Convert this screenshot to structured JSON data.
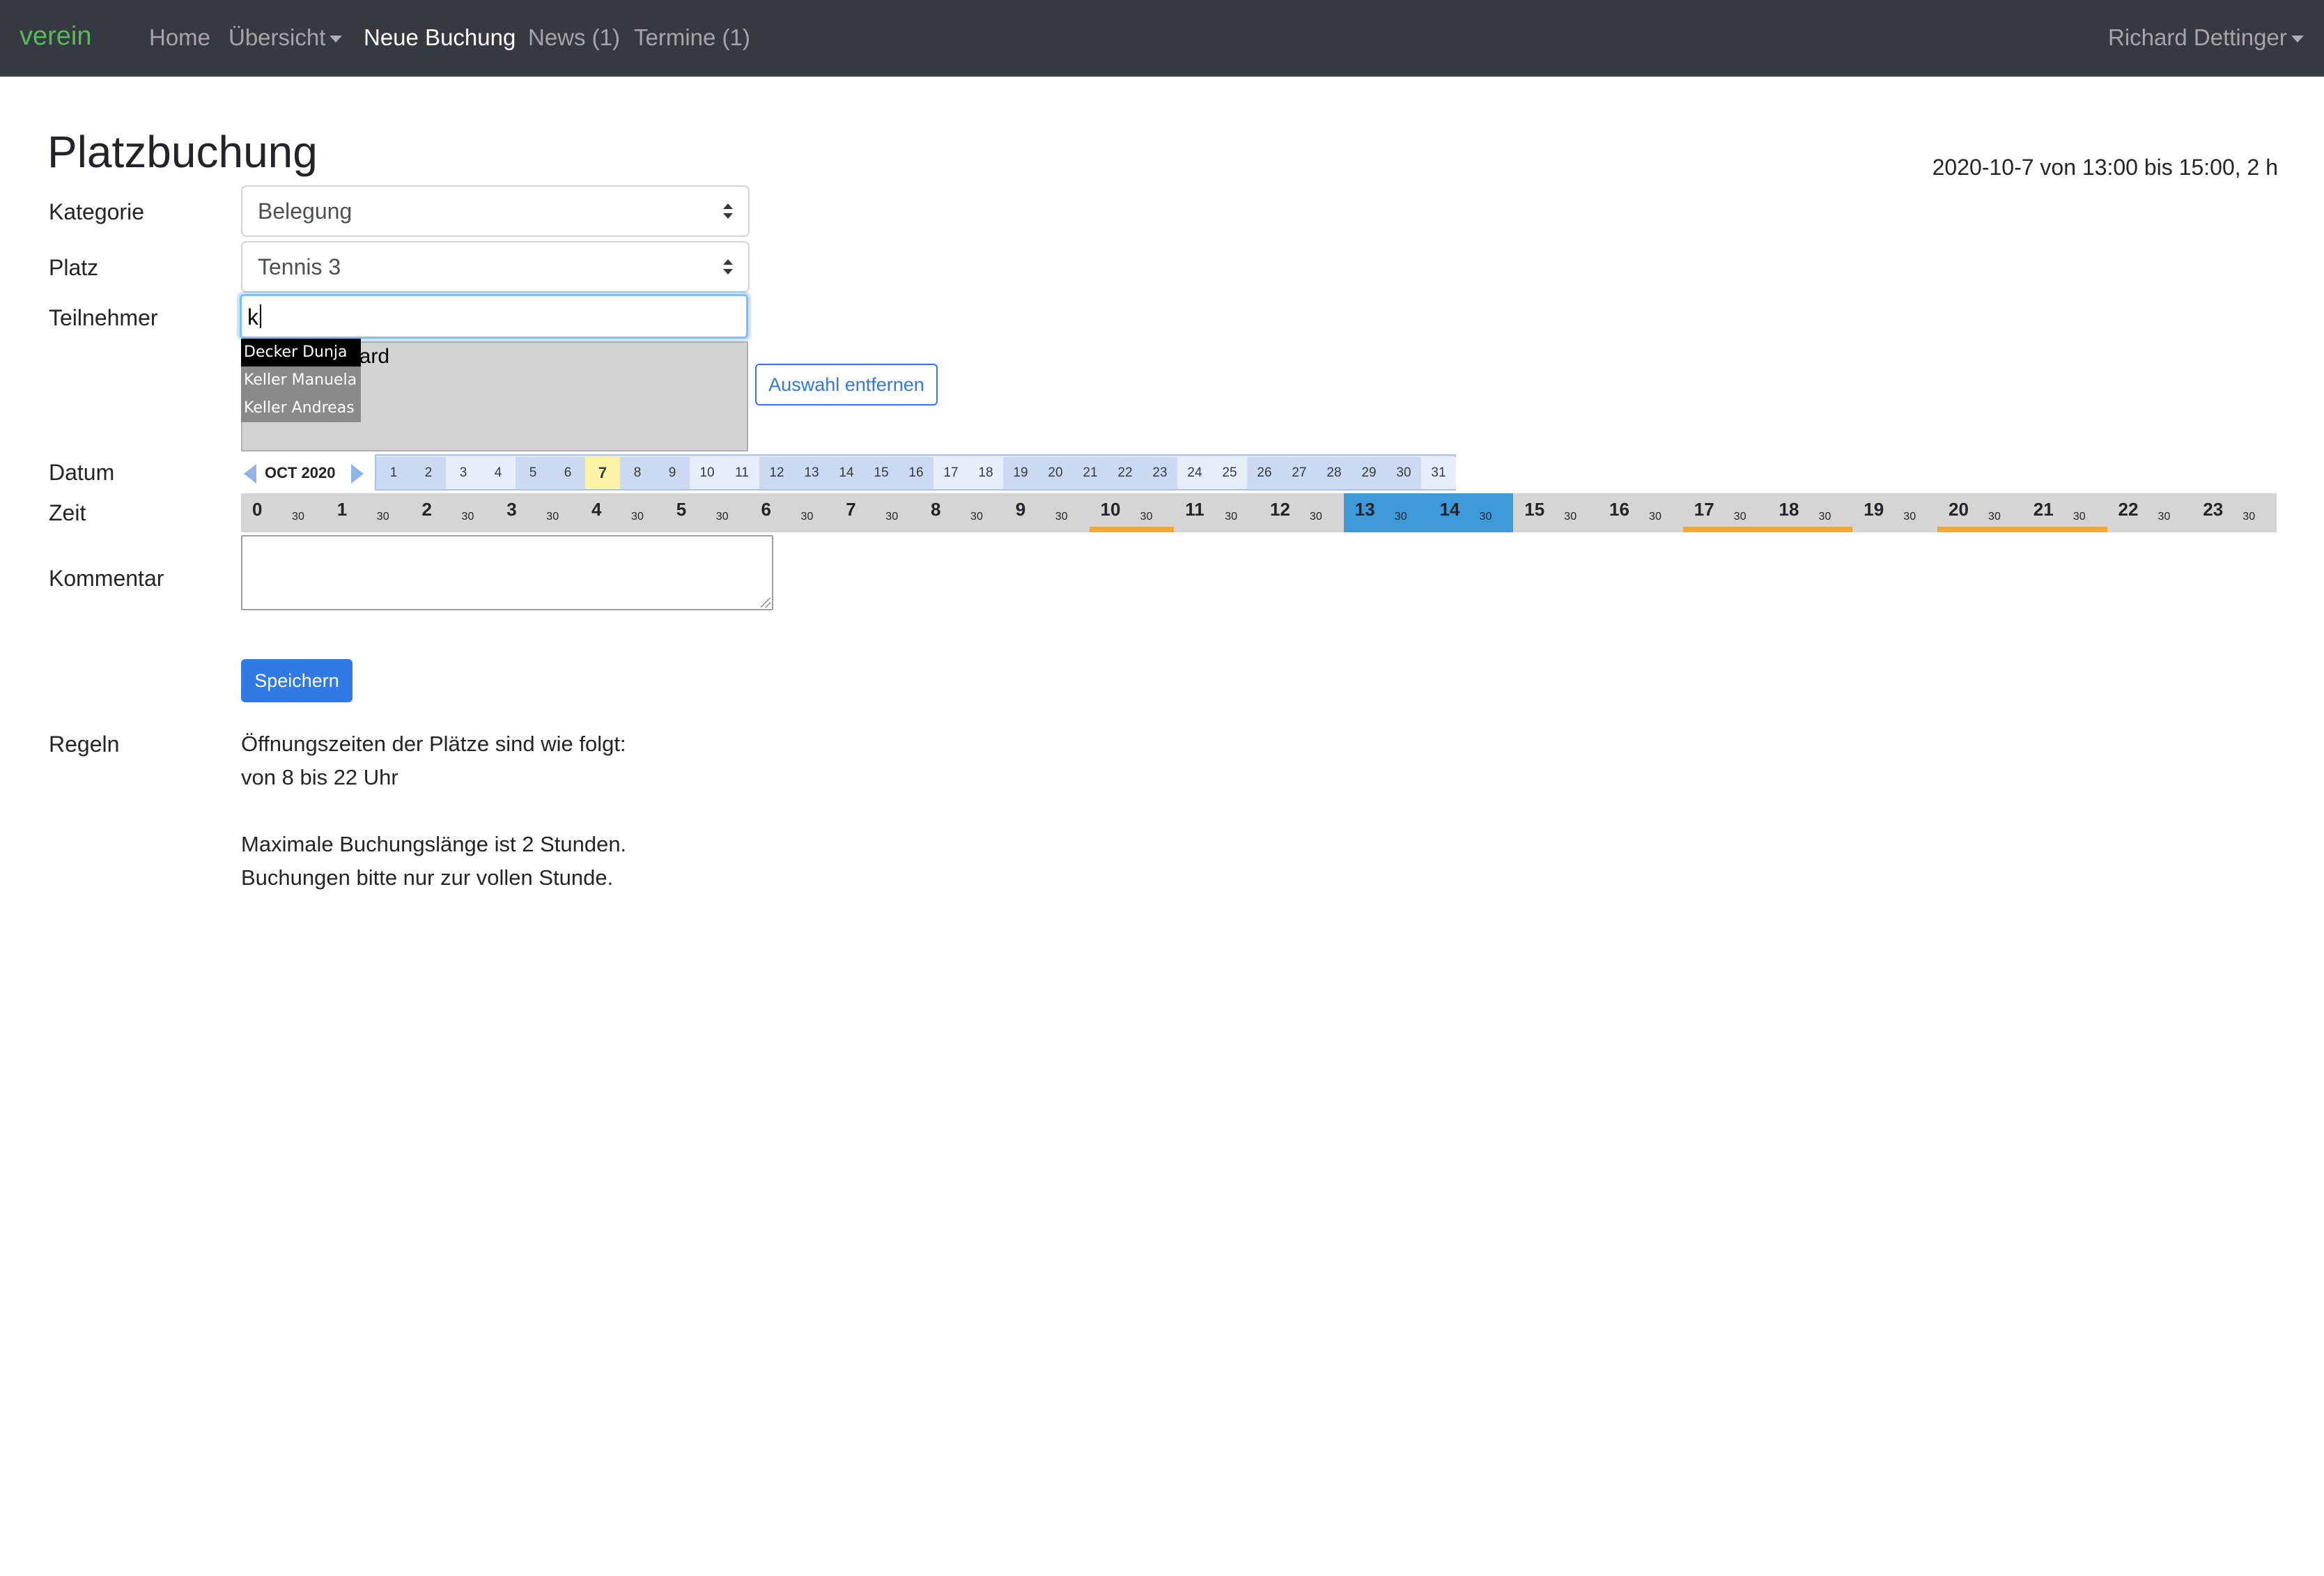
{
  "navbar": {
    "brand": "verein",
    "items": [
      {
        "label": "Home"
      },
      {
        "label": "Übersicht"
      },
      {
        "label": "Neue Buchung"
      },
      {
        "label": "News (1)"
      },
      {
        "label": "Termine (1)"
      }
    ],
    "user": "Richard Dettinger"
  },
  "page": {
    "title": "Platzbuchung",
    "summary": "2020-10-7 von 13:00 bis 15:00, 2 h"
  },
  "form": {
    "kategorie": {
      "label": "Kategorie",
      "value": "Belegung"
    },
    "platz": {
      "label": "Platz",
      "value": "Tennis 3"
    },
    "teilnehmer": {
      "label": "Teilnehmer",
      "input_value": "k",
      "selected_visible": "chard",
      "suggestions": [
        {
          "text": "Decker Dunja"
        },
        {
          "text": "Keller Manuela"
        },
        {
          "text": "Keller Andreas"
        }
      ],
      "remove_button": "Auswahl entfernen"
    },
    "datum": {
      "label": "Datum",
      "month": "OCT 2020",
      "days": [
        "1",
        "2",
        "3",
        "4",
        "5",
        "6",
        "7",
        "8",
        "9",
        "10",
        "11",
        "12",
        "13",
        "14",
        "15",
        "16",
        "17",
        "18",
        "19",
        "20",
        "21",
        "22",
        "23",
        "24",
        "25",
        "26",
        "27",
        "28",
        "29",
        "30",
        "31"
      ],
      "selected_day": "7"
    },
    "zeit": {
      "label": "Zeit",
      "hours": [
        "0",
        "1",
        "2",
        "3",
        "4",
        "5",
        "6",
        "7",
        "8",
        "9",
        "10",
        "11",
        "12",
        "13",
        "14",
        "15",
        "16",
        "17",
        "18",
        "19",
        "20",
        "21",
        "22",
        "23"
      ],
      "half_label": "30",
      "selected_range": "13:00 - 15:00",
      "open_hours": "8 - 22",
      "booked_hours": [
        "10",
        "17",
        "18",
        "20",
        "21"
      ],
      "colors": {
        "selected": "#3f9ad9",
        "open": "#d5d5d5",
        "closed": "#d5d5d5",
        "booked_marker": "#f0a837"
      }
    },
    "kommentar": {
      "label": "Kommentar",
      "value": ""
    },
    "save_button": "Speichern"
  },
  "regeln": {
    "label": "Regeln",
    "lines": [
      "Öffnungszeiten der Plätze sind wie folgt:",
      "von 8 bis 22 Uhr",
      "",
      "Maximale Buchungslänge ist 2 Stunden.",
      "Buchungen bitte nur zur vollen Stunde."
    ]
  },
  "colors": {
    "navbar_bg": "#343a40",
    "brand": "#5cb85c",
    "primary": "#2f7ae5",
    "input_focus": "#80bdff"
  }
}
